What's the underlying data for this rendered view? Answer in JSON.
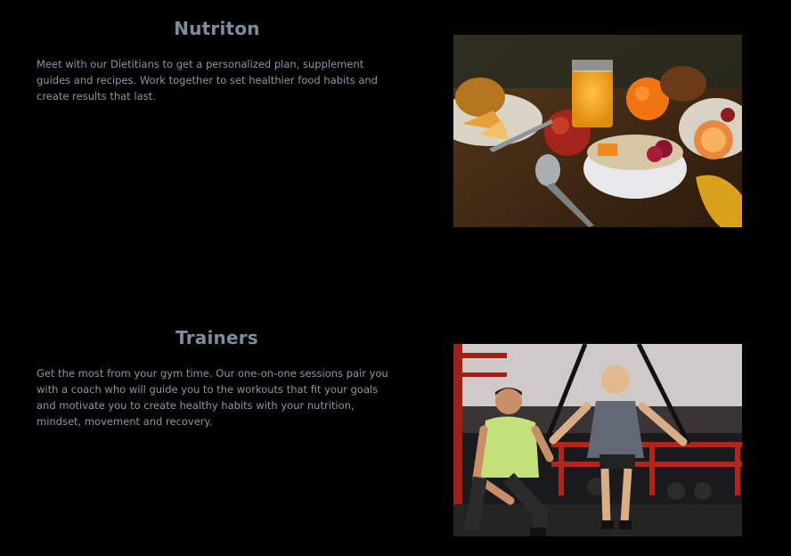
{
  "nutrition": {
    "title": "Nutriton",
    "description": "Meet with our Dietitians to get a personalized plan, supplement guides and recipes. Work together to set healthier food habits and create results that last.",
    "image_alt": "Breakfast table with fruit, orange juice and a bowl of oatmeal with berries"
  },
  "trainers": {
    "title": "Trainers",
    "description": "Get the most from your gym time. Our one-on-one sessions pair you with a coach who will guide you to the workouts that fit your goals and motivate you to create healthy habits with your nutrition, mindset, movement and recovery.",
    "image_alt": "Personal trainer coaching a woman doing suspension strap push-ups in a gym"
  }
}
